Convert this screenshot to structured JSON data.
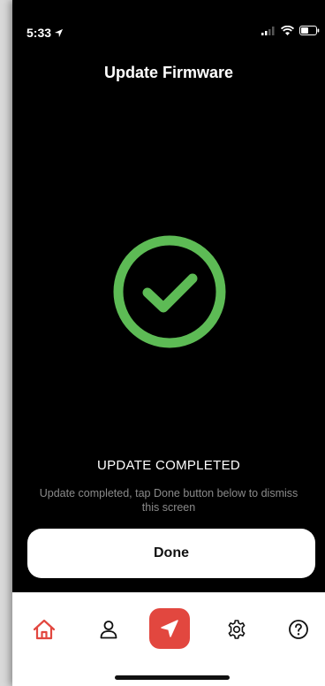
{
  "status_bar": {
    "time": "5:33",
    "icons": [
      "location-arrow-icon",
      "signal-icon",
      "wifi-icon",
      "battery-icon"
    ]
  },
  "header": {
    "title": "Update Firmware"
  },
  "status": {
    "icon": "check-circle-icon",
    "title": "UPDATE COMPLETED",
    "description": "Update completed, tap Done button below to dismiss this screen"
  },
  "actions": {
    "done_label": "Done"
  },
  "tab_bar": {
    "items": [
      {
        "id": "home",
        "icon": "home-icon",
        "active": true
      },
      {
        "id": "profile",
        "icon": "user-icon",
        "active": false
      },
      {
        "id": "navigate",
        "icon": "navigation-arrow-icon",
        "active": false
      },
      {
        "id": "settings",
        "icon": "gear-icon",
        "active": false
      },
      {
        "id": "help",
        "icon": "question-circle-icon",
        "active": false
      }
    ]
  },
  "colors": {
    "background": "#000000",
    "success": "#5dbb55",
    "accent": "#e2473f",
    "secondary_text": "#8a8a8a"
  }
}
